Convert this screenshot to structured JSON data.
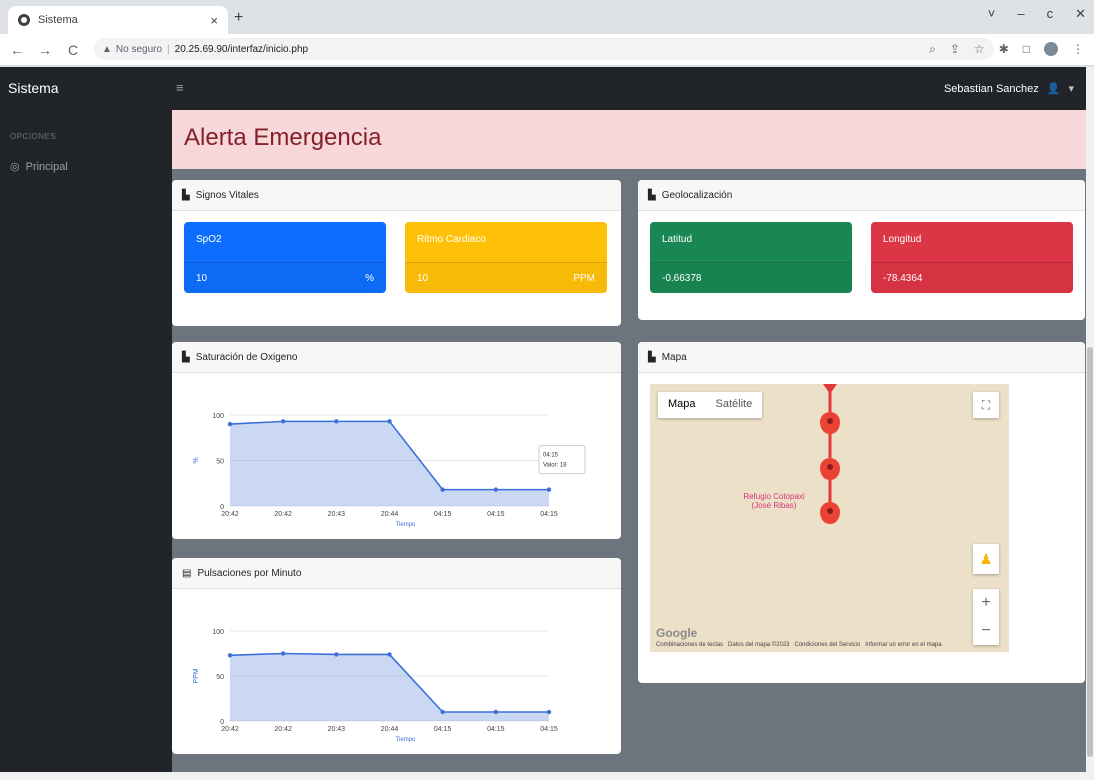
{
  "browser": {
    "tab_title": "Sistema",
    "tab_close": "×",
    "new_tab": "+",
    "nav": {
      "back": "←",
      "forward": "→",
      "reload": "C"
    },
    "security": "No seguro",
    "url": "20.25.69.90/interfaz/inicio.php",
    "window_controls": [
      "˅",
      "–",
      "c",
      "✕"
    ]
  },
  "app": {
    "brand": "Sistema",
    "menu_icon": "≡",
    "user_name": "Sebastian Sanchez",
    "user_caret": "▾"
  },
  "sidebar": {
    "heading": "OPCIONES",
    "items": [
      {
        "label": "Principal",
        "icon": "gauge-icon"
      }
    ]
  },
  "alert": {
    "title": "Alerta Emergencia"
  },
  "vitals": {
    "title": "Signos Vitales",
    "spo2": {
      "label": "SpO2",
      "value": "10",
      "unit": "%"
    },
    "heart": {
      "label": "Ritmo Cardiaco",
      "value": "10",
      "unit": "PPM"
    }
  },
  "geo": {
    "title": "Geolocalización",
    "lat": {
      "label": "Latitud",
      "value": "-0.66378"
    },
    "lon": {
      "label": "Longitud",
      "value": "-78.4364"
    }
  },
  "map_card": {
    "title": "Mapa",
    "map_btn": "Mapa",
    "sat_btn": "Satélite",
    "place": "Refugio Cotopaxi (José Ribas)",
    "google": "Google",
    "footer": [
      "Combinaciones de teclas",
      "Datos del mapa ©2023",
      "Condiciones del Servicio",
      "Informar un error en el mapa"
    ]
  },
  "chart_data": [
    {
      "type": "area",
      "title": "Saturación de Oxigeno",
      "xlabel": "Tiempo",
      "ylabel": "%",
      "categories": [
        "20:42",
        "20:42",
        "20:43",
        "20:44",
        "04:15",
        "04:15",
        "04:15"
      ],
      "values": [
        90,
        93,
        93,
        93,
        18,
        18,
        18
      ],
      "ylim": [
        0,
        100
      ],
      "yticks": [
        "0",
        "50",
        "100"
      ],
      "tooltip": {
        "time": "04:15",
        "text": "Valor: 18"
      }
    },
    {
      "type": "area",
      "title": "Pulsaciones por Minuto",
      "xlabel": "Tiempo",
      "ylabel": "PPM",
      "categories": [
        "20:42",
        "20:42",
        "20:43",
        "20:44",
        "04:15",
        "04:15",
        "04:15"
      ],
      "values": [
        73,
        75,
        74,
        74,
        10,
        10,
        10
      ],
      "ylim": [
        0,
        100
      ],
      "yticks": [
        "0",
        "50",
        "100"
      ]
    }
  ]
}
